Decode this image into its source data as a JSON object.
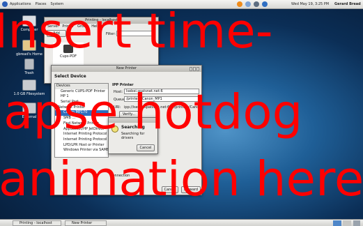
{
  "topbar": {
    "menus": [
      "Applications",
      "Places",
      "System"
    ],
    "clock": "Wed May 19, 3:25 PM",
    "user": "Gerard Bread"
  },
  "desktop": {
    "icons": [
      "Computer",
      "gbread's Home",
      "Trash",
      "1.0 GB Filesystem",
      "External"
    ]
  },
  "printing_window": {
    "title": "Printing - localhost",
    "menu": [
      "Server",
      "Printer",
      "Group",
      "Help"
    ],
    "add_button": "Add",
    "filter_label": "Filter:",
    "printer_icon": "Cups-PDF"
  },
  "new_printer": {
    "title": "New Printer",
    "heading": "Select Device",
    "devices_label": "Devices",
    "devices": [
      "Generic CUPS-PDF Printer",
      "HP 1",
      "Serial Port",
      "Network Printer",
      "Canon MP170",
      "SMB ...",
      "Find Network Printer",
      "AppSocket/HP JetDirect",
      "Internet Printing Protocol",
      "Internet Printing Protocol",
      "LPD/LPR Host or Printer",
      "Windows Printer via SAMBA"
    ],
    "ipp_label": "IPP Printer",
    "host_label": "Host:",
    "host_value": "Isebei.spatsnet.net:6",
    "queue_label": "Queue:",
    "queue_value": "/printers/Canon_MP1",
    "uri_label": "URI:",
    "uri_value": "ipp://isebei.spatsnet.net:631/printers/Canon",
    "verify_button": "Verify...",
    "connection_label": "Connection",
    "cancel_button": "Cancel",
    "forward_button": "Forward"
  },
  "searching_dialog": {
    "title": "Searching",
    "message": "Searching for drivers",
    "cancel_button": "Cancel"
  },
  "overlay": {
    "line1": "Insert time-",
    "line2": "lapse hotdog",
    "line3": "animation here"
  },
  "taskbar": {
    "items": [
      "Printing - localhost",
      "New Printer"
    ]
  }
}
